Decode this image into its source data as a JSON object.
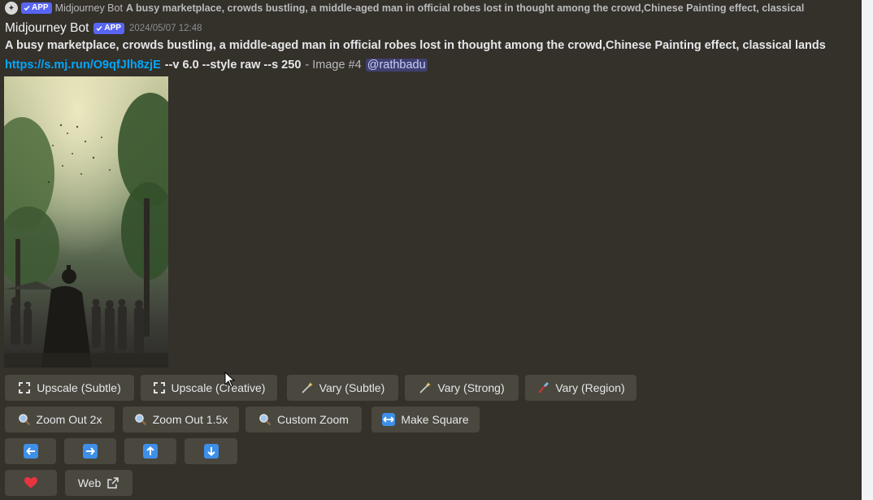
{
  "reply": {
    "avatar_letter": "✦",
    "badge": "APP",
    "author": "Midjourney Bot",
    "text": "A busy marketplace, crowds bustling, a middle-aged man in official robes lost in thought among the crowd,Chinese Painting effect, classical"
  },
  "message": {
    "author": "Midjourney Bot",
    "badge": "APP",
    "timestamp": "2024/05/07 12:48",
    "prompt": "A busy marketplace, crowds bustling, a middle-aged man in official robes lost in thought among the crowd,Chinese Painting effect, classical lands",
    "link": "https://s.mj.run/O9qfJlh8zjE",
    "params": "--v 6.0 --style raw --s 250",
    "image_label": "- Image #4",
    "mention": "@rathbadu"
  },
  "buttons": {
    "upscale_subtle": "Upscale (Subtle)",
    "upscale_creative": "Upscale (Creative)",
    "vary_subtle": "Vary (Subtle)",
    "vary_strong": "Vary (Strong)",
    "vary_region": "Vary (Region)",
    "zoom_out_2x": "Zoom Out 2x",
    "zoom_out_15x": "Zoom Out 1.5x",
    "custom_zoom": "Custom Zoom",
    "make_square": "Make Square",
    "web": "Web"
  },
  "icons": {
    "upscale": "expand-arrows-icon",
    "vary": "sparkle-wand-icon",
    "vary_region": "paintbrush-icon",
    "zoom": "magnifier-icon",
    "make_square": "horizontal-arrows-icon",
    "pan": [
      "arrow-left-icon",
      "arrow-right-icon",
      "arrow-up-icon",
      "arrow-down-icon"
    ],
    "favorite": "heart-icon",
    "external": "external-link-icon"
  },
  "colors": {
    "background": "#34302a",
    "button": "#4a473f",
    "link": "#00a8fc",
    "badge": "#5865f2",
    "mention_bg": "#3e4070",
    "arrow": "#3d8fe8",
    "heart": "#e8343f"
  }
}
